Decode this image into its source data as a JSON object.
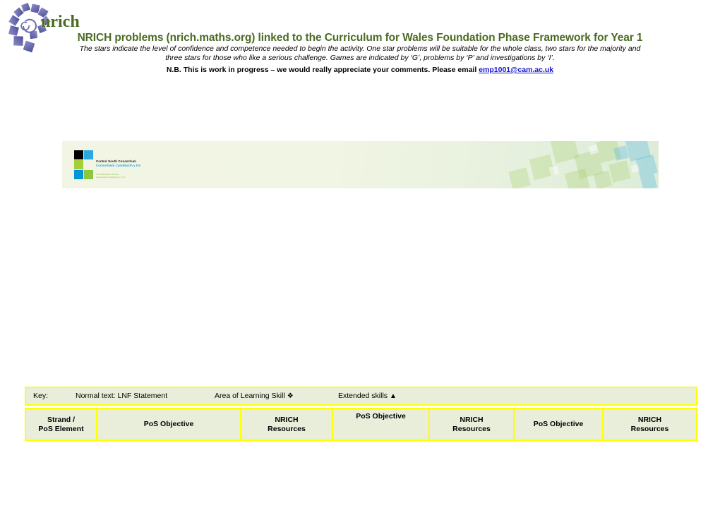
{
  "header": {
    "logo_alt": "nrich",
    "logo_wordmark": "nrich",
    "title": "NRICH problems (nrich.maths.org) linked to the Curriculum for Wales Foundation Phase Framework for Year 1",
    "subtitle_line1": "The stars indicate the level of confidence and competence needed to begin the activity.  One star problems will be suitable for the whole class, two stars for the majority and",
    "subtitle_line2": "three stars for those who like a serious challenge. Games are indicated by ‘G’, problems by ‘P’ and investigations by ‘I’.",
    "nb_text": "N.B. This is work in progress – we would really appreciate your comments.  Please email ",
    "nb_email": "emp1001@cam.ac.uk",
    "title_color": "#4b6b24",
    "email_color": "#1414cf"
  },
  "banner": {
    "org_name_en": "Central South Consortium",
    "org_name_cy": "Consortiwm Canolbarth y De",
    "tagline_en": "Joint Education Service",
    "tagline_cy": "Gwasanaeth Addysg ar y Cyd",
    "square_colors": [
      "#000000",
      "#29abe2",
      "#a6ce39",
      "#ffffff",
      "#0095da",
      "#8dc63f"
    ],
    "background_light": "#f2f5e4",
    "background_accent": "#dcecd7"
  },
  "key": {
    "label": "Key:",
    "normal_text": "Normal text: LNF Statement",
    "area_of_learning": "Area of Learning Skill",
    "area_symbol": "❖",
    "extended_skills": "Extended skills",
    "extended_symbol": "▲",
    "border_color": "#ffff00",
    "cell_background": "#e9eedb"
  },
  "table": {
    "columns": [
      {
        "label": "Strand /\nPoS Element",
        "line1": "Strand /",
        "line2": "PoS Element",
        "align": "center"
      },
      {
        "label": "PoS Objective",
        "line1": "PoS Objective",
        "line2": "",
        "align": "center"
      },
      {
        "label": "NRICH Resources",
        "line1": "NRICH",
        "line2": "Resources",
        "align": "center"
      },
      {
        "label": "PoS Objective",
        "line1": "PoS Objective",
        "line2": "",
        "align": "top"
      },
      {
        "label": "NRICH Resources",
        "line1": "NRICH",
        "line2": "Resources",
        "align": "center"
      },
      {
        "label": "PoS Objective",
        "line1": "PoS Objective",
        "line2": "",
        "align": "center"
      },
      {
        "label": "NRICH Resources",
        "line1": "NRICH",
        "line2": "Resources",
        "align": "center"
      }
    ]
  }
}
